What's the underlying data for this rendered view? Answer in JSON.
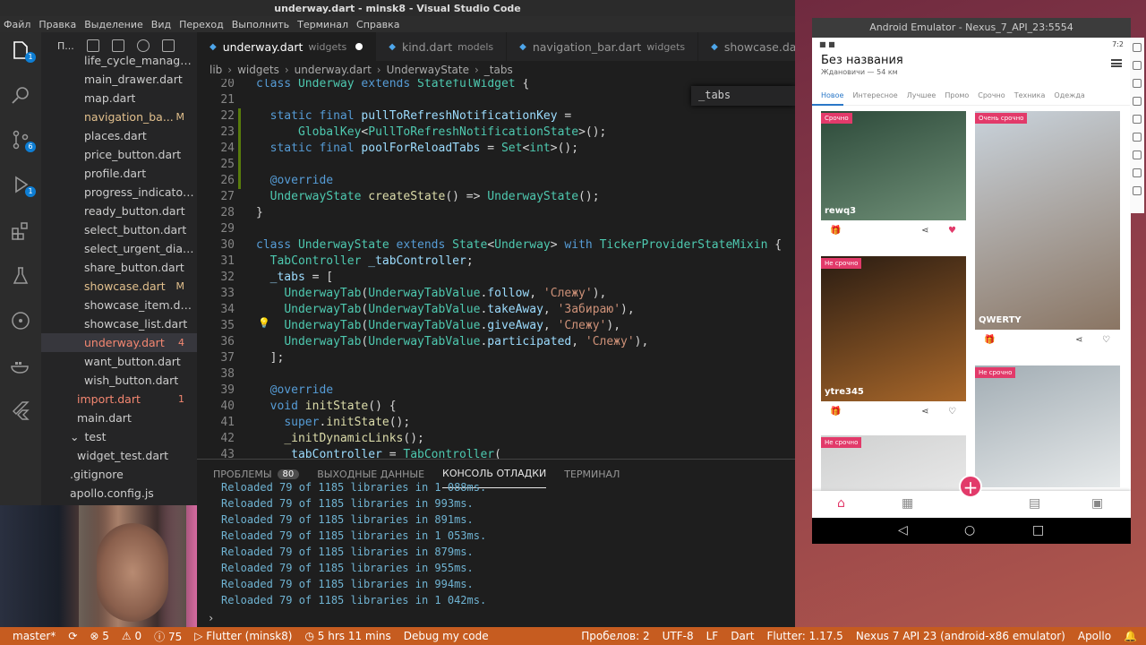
{
  "window": {
    "title": "underway.dart - minsk8 - Visual Studio Code"
  },
  "menu": [
    "Файл",
    "Правка",
    "Выделение",
    "Вид",
    "Переход",
    "Выполнить",
    "Терминал",
    "Справка"
  ],
  "activity": {
    "explorer_badge": "1",
    "scm_badge": "6",
    "debug_badge": "1"
  },
  "sidebar": {
    "header": "П...",
    "files": [
      {
        "name": "life_cycle_manager...",
        "flag": "",
        "color": "#cccccc",
        "indent": 48
      },
      {
        "name": "main_drawer.dart",
        "flag": "",
        "color": "#cccccc",
        "indent": 48
      },
      {
        "name": "map.dart",
        "flag": "",
        "color": "#cccccc",
        "indent": 48
      },
      {
        "name": "navigation_ba...",
        "flag": "M",
        "color": "#e2c08d",
        "indent": 48
      },
      {
        "name": "places.dart",
        "flag": "",
        "color": "#cccccc",
        "indent": 48
      },
      {
        "name": "price_button.dart",
        "flag": "",
        "color": "#cccccc",
        "indent": 48
      },
      {
        "name": "profile.dart",
        "flag": "",
        "color": "#cccccc",
        "indent": 48
      },
      {
        "name": "progress_indicator....",
        "flag": "",
        "color": "#cccccc",
        "indent": 48
      },
      {
        "name": "ready_button.dart",
        "flag": "",
        "color": "#cccccc",
        "indent": 48
      },
      {
        "name": "select_button.dart",
        "flag": "",
        "color": "#cccccc",
        "indent": 48
      },
      {
        "name": "select_urgent_dialo...",
        "flag": "",
        "color": "#cccccc",
        "indent": 48
      },
      {
        "name": "share_button.dart",
        "flag": "",
        "color": "#cccccc",
        "indent": 48
      },
      {
        "name": "showcase.dart",
        "flag": "M",
        "color": "#e2c08d",
        "indent": 48
      },
      {
        "name": "showcase_item.dart",
        "flag": "",
        "color": "#cccccc",
        "indent": 48
      },
      {
        "name": "showcase_list.dart",
        "flag": "",
        "color": "#cccccc",
        "indent": 48
      },
      {
        "name": "underway.dart",
        "flag": "4",
        "color": "#f48771",
        "indent": 48,
        "selected": true
      },
      {
        "name": "want_button.dart",
        "flag": "",
        "color": "#cccccc",
        "indent": 48
      },
      {
        "name": "wish_button.dart",
        "flag": "",
        "color": "#cccccc",
        "indent": 48
      },
      {
        "name": "import.dart",
        "flag": "1",
        "color": "#f48771",
        "indent": 40
      },
      {
        "name": "main.dart",
        "flag": "",
        "color": "#cccccc",
        "indent": 40
      },
      {
        "name": "test",
        "flag": "",
        "color": "#cccccc",
        "indent": 32,
        "folder": true
      },
      {
        "name": "widget_test.dart",
        "flag": "",
        "color": "#cccccc",
        "indent": 40
      },
      {
        "name": ".gitignore",
        "flag": "",
        "color": "#cccccc",
        "indent": 32
      },
      {
        "name": "apollo.config.js",
        "flag": "",
        "color": "#cccccc",
        "indent": 32
      }
    ]
  },
  "tabs": [
    {
      "name": "underway.dart",
      "dir": "widgets",
      "active": true,
      "dirty": true
    },
    {
      "name": "kind.dart",
      "dir": "models",
      "active": false
    },
    {
      "name": "navigation_bar.dart",
      "dir": "widgets",
      "active": false
    },
    {
      "name": "showcase.dart",
      "dir": "",
      "active": false
    }
  ],
  "breadcrumb": [
    "lib",
    "widgets",
    "underway.dart",
    "UnderwayState",
    "_tabs"
  ],
  "outline_widget": "_tabs",
  "code": [
    {
      "n": "20",
      "html": "<span class='kw'>class</span> <span class='ty'>Underway</span> <span class='kw'>extends</span> <span class='ty'>StatefulWidget</span> {"
    },
    {
      "n": "21",
      "html": ""
    },
    {
      "n": "22",
      "html": "  <span class='kw'>static</span> <span class='kw'>final</span> <span class='vr'>pullToRefreshNotificationKey</span> ="
    },
    {
      "n": "23",
      "html": "      <span class='ty'>GlobalKey</span>&lt;<span class='ty'>PullToRefreshNotificationState</span>&gt;();"
    },
    {
      "n": "24",
      "html": "  <span class='kw'>static</span> <span class='kw'>final</span> <span class='vr'>poolForReloadTabs</span> = <span class='ty'>Set</span>&lt;<span class='ty'>int</span>&gt;();"
    },
    {
      "n": "25",
      "html": ""
    },
    {
      "n": "26",
      "html": "  <span class='kw'>@override</span>"
    },
    {
      "n": "27",
      "html": "  <span class='ty'>UnderwayState</span> <span class='fn'>createState</span>() =&gt; <span class='ty'>UnderwayState</span>();"
    },
    {
      "n": "28",
      "html": "}"
    },
    {
      "n": "29",
      "html": ""
    },
    {
      "n": "30",
      "html": "<span class='kw'>class</span> <span class='ty'>UnderwayState</span> <span class='kw'>extends</span> <span class='ty'>State</span>&lt;<span class='ty'>Underway</span>&gt; <span class='kw'>with</span> <span class='ty'>TickerProviderStateMixin</span> {"
    },
    {
      "n": "31",
      "html": "  <span class='ty'>TabController</span> <span class='vr'>_tabController</span>;"
    },
    {
      "n": "32",
      "html": "  <span class='vr'>_tabs</span> = ["
    },
    {
      "n": "33",
      "html": "    <span class='ty'>UnderwayTab</span>(<span class='ty'>UnderwayTabValue</span>.<span class='vr'>follow</span>, <span class='st'>'Слежу'</span>),"
    },
    {
      "n": "34",
      "html": "    <span class='ty'>UnderwayTab</span>(<span class='ty'>UnderwayTabValue</span>.<span class='vr'>takeAway</span>, <span class='st'>'Забираю'</span>),"
    },
    {
      "n": "35",
      "html": "    <span class='ty'>UnderwayTab</span>(<span class='ty'>UnderwayTabValue</span>.<span class='vr'>giveAway</span>, <span class='st'>'Слежу'</span>),"
    },
    {
      "n": "36",
      "html": "    <span class='ty'>UnderwayTab</span>(<span class='ty'>UnderwayTabValue</span>.<span class='vr'>participated</span>, <span class='st'>'Слежу'</span>),"
    },
    {
      "n": "37",
      "html": "  ];"
    },
    {
      "n": "38",
      "html": ""
    },
    {
      "n": "39",
      "html": "  <span class='kw'>@override</span>"
    },
    {
      "n": "40",
      "html": "  <span class='kw'>void</span> <span class='fn'>initState</span>() {"
    },
    {
      "n": "41",
      "html": "    <span class='kw'>super</span>.<span class='fn'>initState</span>();"
    },
    {
      "n": "42",
      "html": "    <span class='fn'>_initDynamicLinks</span>();"
    },
    {
      "n": "43",
      "html": "    <span class='vr'>_tabController</span> = <span class='ty'>TabController</span>("
    }
  ],
  "panel": {
    "tabs": [
      {
        "label": "ПРОБЛЕМЫ",
        "count": "80"
      },
      {
        "label": "ВЫХОДНЫЕ ДАННЫЕ"
      },
      {
        "label": "КОНСОЛЬ ОТЛАДКИ",
        "active": true
      },
      {
        "label": "ТЕРМИНАЛ"
      }
    ],
    "lines": [
      "Reloaded 79 of 1185 libraries in 1 088ms.",
      "Reloaded 79 of 1185 libraries in 993ms.",
      "Reloaded 79 of 1185 libraries in 891ms.",
      "Reloaded 79 of 1185 libraries in 1 053ms.",
      "Reloaded 79 of 1185 libraries in 879ms.",
      "Reloaded 79 of 1185 libraries in 955ms.",
      "Reloaded 79 of 1185 libraries in 994ms.",
      "Reloaded 79 of 1185 libraries in 1 042ms."
    ],
    "prompt": "›"
  },
  "status": {
    "branch": "master*",
    "sync": "⟳",
    "errors": "⊗ 5",
    "warnings": "⚠ 0",
    "info": "ⓘ 75",
    "flutter": "▷ Flutter (minsk8)",
    "time": "◷ 5 hrs 11 mins",
    "mode": "Debug my code",
    "spaces": "Пробелов: 2",
    "encoding": "UTF-8",
    "eol": "LF",
    "lang": "Dart",
    "flutter_ver": "Flutter: 1.17.5",
    "device": "Nexus 7 API 23 (android-x86 emulator)",
    "apollo": "Apollo",
    "bell": "🔔"
  },
  "emulator": {
    "title": "Android Emulator - Nexus_7_API_23:5554",
    "clock": "7:2",
    "app_title": "Без названия",
    "app_sub": "Ждановичи — 54 км",
    "categories": [
      "Новое",
      "Интересное",
      "Лучшее",
      "Промо",
      "Срочно",
      "Техника",
      "Одежда"
    ],
    "cards": [
      {
        "tag": "Срочно",
        "caption": "rewq3",
        "color1": "#2d4a3a",
        "color2": "#6f8f77",
        "liked": true
      },
      {
        "tag": "Очень срочно",
        "caption": "QWERTY",
        "color1": "#c9d3dc",
        "color2": "#8a7563",
        "liked": false
      },
      {
        "tag": "Не срочно",
        "caption": "ytre345",
        "color1": "#2a1c12",
        "color2": "#a8672a",
        "liked": false
      },
      {
        "tag": "Не срочно",
        "caption": "",
        "color1": "#a2adb4",
        "color2": "#e6e9ea",
        "liked": false
      },
      {
        "tag": "Не срочно",
        "caption": "",
        "color1": "#cfd0d0",
        "color2": "#e8e8e8",
        "liked": false
      }
    ]
  }
}
